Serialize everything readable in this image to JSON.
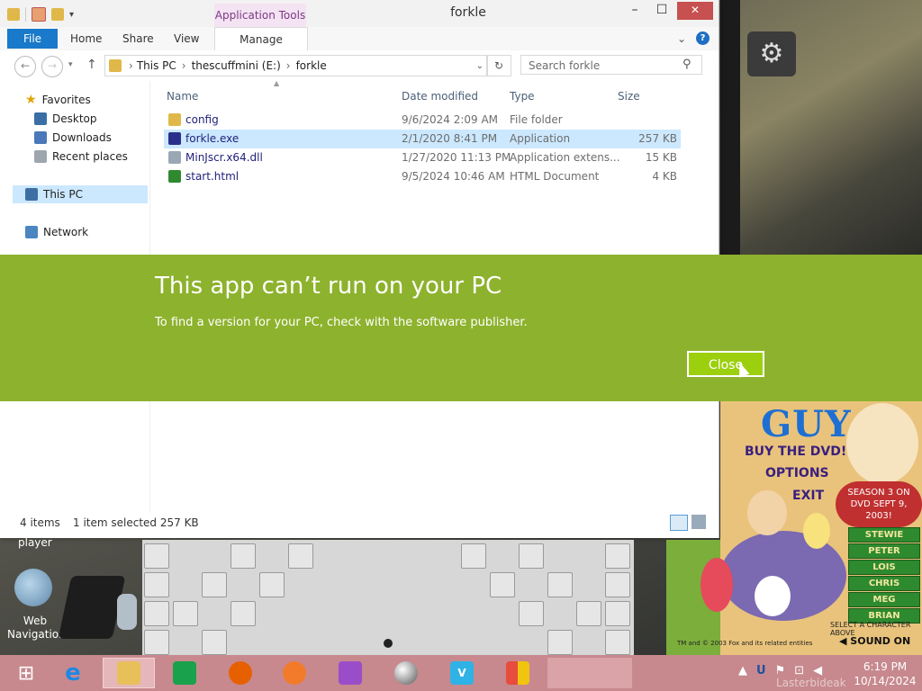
{
  "window": {
    "title": "forkle",
    "context_tab_group": "Application Tools",
    "controls": {
      "minimize": "–",
      "maximize": "☐",
      "close": "✕"
    }
  },
  "ribbon": {
    "tabs": [
      "File",
      "Home",
      "Share",
      "View",
      "Manage"
    ],
    "help": "?",
    "collapse": "⌄"
  },
  "address": {
    "crumbs": [
      "This PC",
      "thescuffmini (E:)",
      "forkle"
    ],
    "sep": "›",
    "search_placeholder": "Search forkle"
  },
  "sidebar": {
    "favorites": "Favorites",
    "items": [
      "Desktop",
      "Downloads",
      "Recent places"
    ],
    "this_pc": "This PC",
    "network": "Network"
  },
  "columns": {
    "name": "Name",
    "modified": "Date modified",
    "type": "Type",
    "size": "Size"
  },
  "files": [
    {
      "name": "config",
      "modified": "9/6/2024 2:09 AM",
      "type": "File folder",
      "size": "",
      "icon": "folder-icon",
      "selected": false
    },
    {
      "name": "forkle.exe",
      "modified": "2/1/2020 8:41 PM",
      "type": "Application",
      "size": "257 KB",
      "icon": "exe-icon",
      "selected": true
    },
    {
      "name": "MinJscr.x64.dll",
      "modified": "1/27/2020 11:13 PM",
      "type": "Application extens...",
      "size": "15 KB",
      "icon": "dll-icon",
      "selected": false
    },
    {
      "name": "start.html",
      "modified": "9/5/2024 10:46 AM",
      "type": "HTML Document",
      "size": "4 KB",
      "icon": "html-icon",
      "selected": false
    }
  ],
  "status": {
    "count": "4 items",
    "selection": "1 item selected  257 KB"
  },
  "dialog": {
    "title": "This app can’t run on your PC",
    "message": "To find a version for your PC, check with the software publisher.",
    "close_label": "Close",
    "bg_color": "#8db22d"
  },
  "game": {
    "title": "GUY",
    "buy": "BUY THE DVD!",
    "options": "OPTIONS",
    "exit": "EXIT",
    "season": "SEASON 3 ON DVD SEPT 9, 2003!",
    "characters": [
      "STEWIE",
      "PETER",
      "LOIS",
      "CHRIS",
      "MEG",
      "BRIAN"
    ],
    "select_hint": "SELECT A CHARACTER ABOVE",
    "sound": "SOUND ON",
    "trademark": "TM and © 2003 Fox and its related entities"
  },
  "desktop": {
    "player_label": "player",
    "web_nav_label": "Web Navigation"
  },
  "taskbar": {
    "apps": [
      "start",
      "internet-explorer",
      "file-explorer",
      "store",
      "firefox",
      "paint",
      "game-char",
      "marble",
      "vimeo",
      "office"
    ],
    "time": "6:19 PM",
    "date": "10/14/2024",
    "watermark": "Lasterbideak"
  }
}
